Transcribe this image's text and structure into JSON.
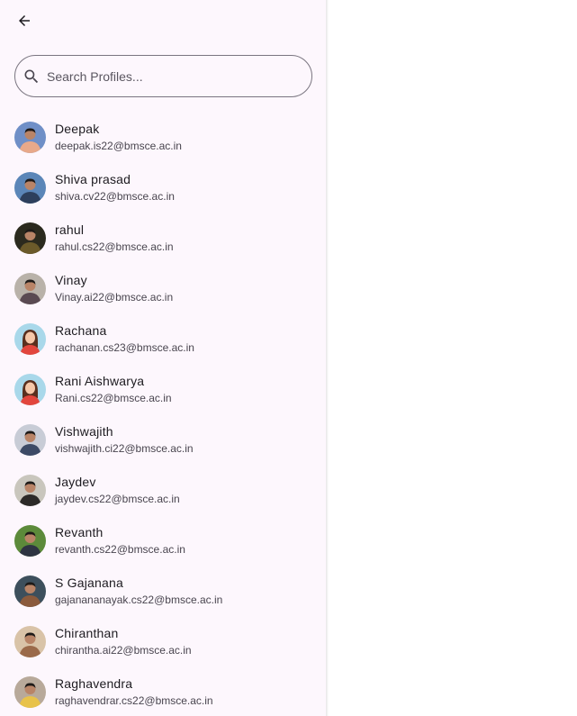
{
  "header": {
    "back_icon": "arrow-back-icon"
  },
  "search": {
    "placeholder": "Search Profiles...",
    "value": "",
    "icon": "search-icon"
  },
  "profiles": [
    {
      "name": "Deepak",
      "email": "deepak.is22@bmsce.ac.in",
      "avatar_bg": "#6f8fc7",
      "avatar_fg": "#e8a98a",
      "avatar_type": "photo"
    },
    {
      "name": "Shiva prasad",
      "email": "shiva.cv22@bmsce.ac.in",
      "avatar_bg": "#5b86b8",
      "avatar_fg": "#2d3f5c",
      "avatar_type": "photo"
    },
    {
      "name": "rahul",
      "email": "rahul.cs22@bmsce.ac.in",
      "avatar_bg": "#2b2a1e",
      "avatar_fg": "#6b5a2a",
      "avatar_type": "photo"
    },
    {
      "name": "Vinay",
      "email": "Vinay.ai22@bmsce.ac.in",
      "avatar_bg": "#b9b2a9",
      "avatar_fg": "#5a4a52",
      "avatar_type": "photo"
    },
    {
      "name": "Rachana",
      "email": "rachanan.cs23@bmsce.ac.in",
      "avatar_bg": "#a9d8ea",
      "avatar_fg": "#e2463d",
      "avatar_type": "illustration"
    },
    {
      "name": "Rani Aishwarya",
      "email": "Rani.cs22@bmsce.ac.in",
      "avatar_bg": "#a9d8ea",
      "avatar_fg": "#e2463d",
      "avatar_type": "illustration"
    },
    {
      "name": "Vishwajith",
      "email": "vishwajith.ci22@bmsce.ac.in",
      "avatar_bg": "#c8ccd6",
      "avatar_fg": "#3c4a66",
      "avatar_type": "photo"
    },
    {
      "name": "Jaydev",
      "email": "jaydev.cs22@bmsce.ac.in",
      "avatar_bg": "#c9c6bd",
      "avatar_fg": "#2c2a28",
      "avatar_type": "photo"
    },
    {
      "name": "Revanth",
      "email": "revanth.cs22@bmsce.ac.in",
      "avatar_bg": "#5c8a3a",
      "avatar_fg": "#2e3442",
      "avatar_type": "photo"
    },
    {
      "name": "S Gajanana",
      "email": "gajanananayak.cs22@bmsce.ac.in",
      "avatar_bg": "#3d4f5c",
      "avatar_fg": "#8b5a3c",
      "avatar_type": "photo"
    },
    {
      "name": "Chiranthan",
      "email": "chirantha.ai22@bmsce.ac.in",
      "avatar_bg": "#d9c3a8",
      "avatar_fg": "#9b6a4a",
      "avatar_type": "photo"
    },
    {
      "name": "Raghavendra",
      "email": "raghavendrar.cs22@bmsce.ac.in",
      "avatar_bg": "#b8a99a",
      "avatar_fg": "#e8c24a",
      "avatar_type": "photo"
    }
  ]
}
